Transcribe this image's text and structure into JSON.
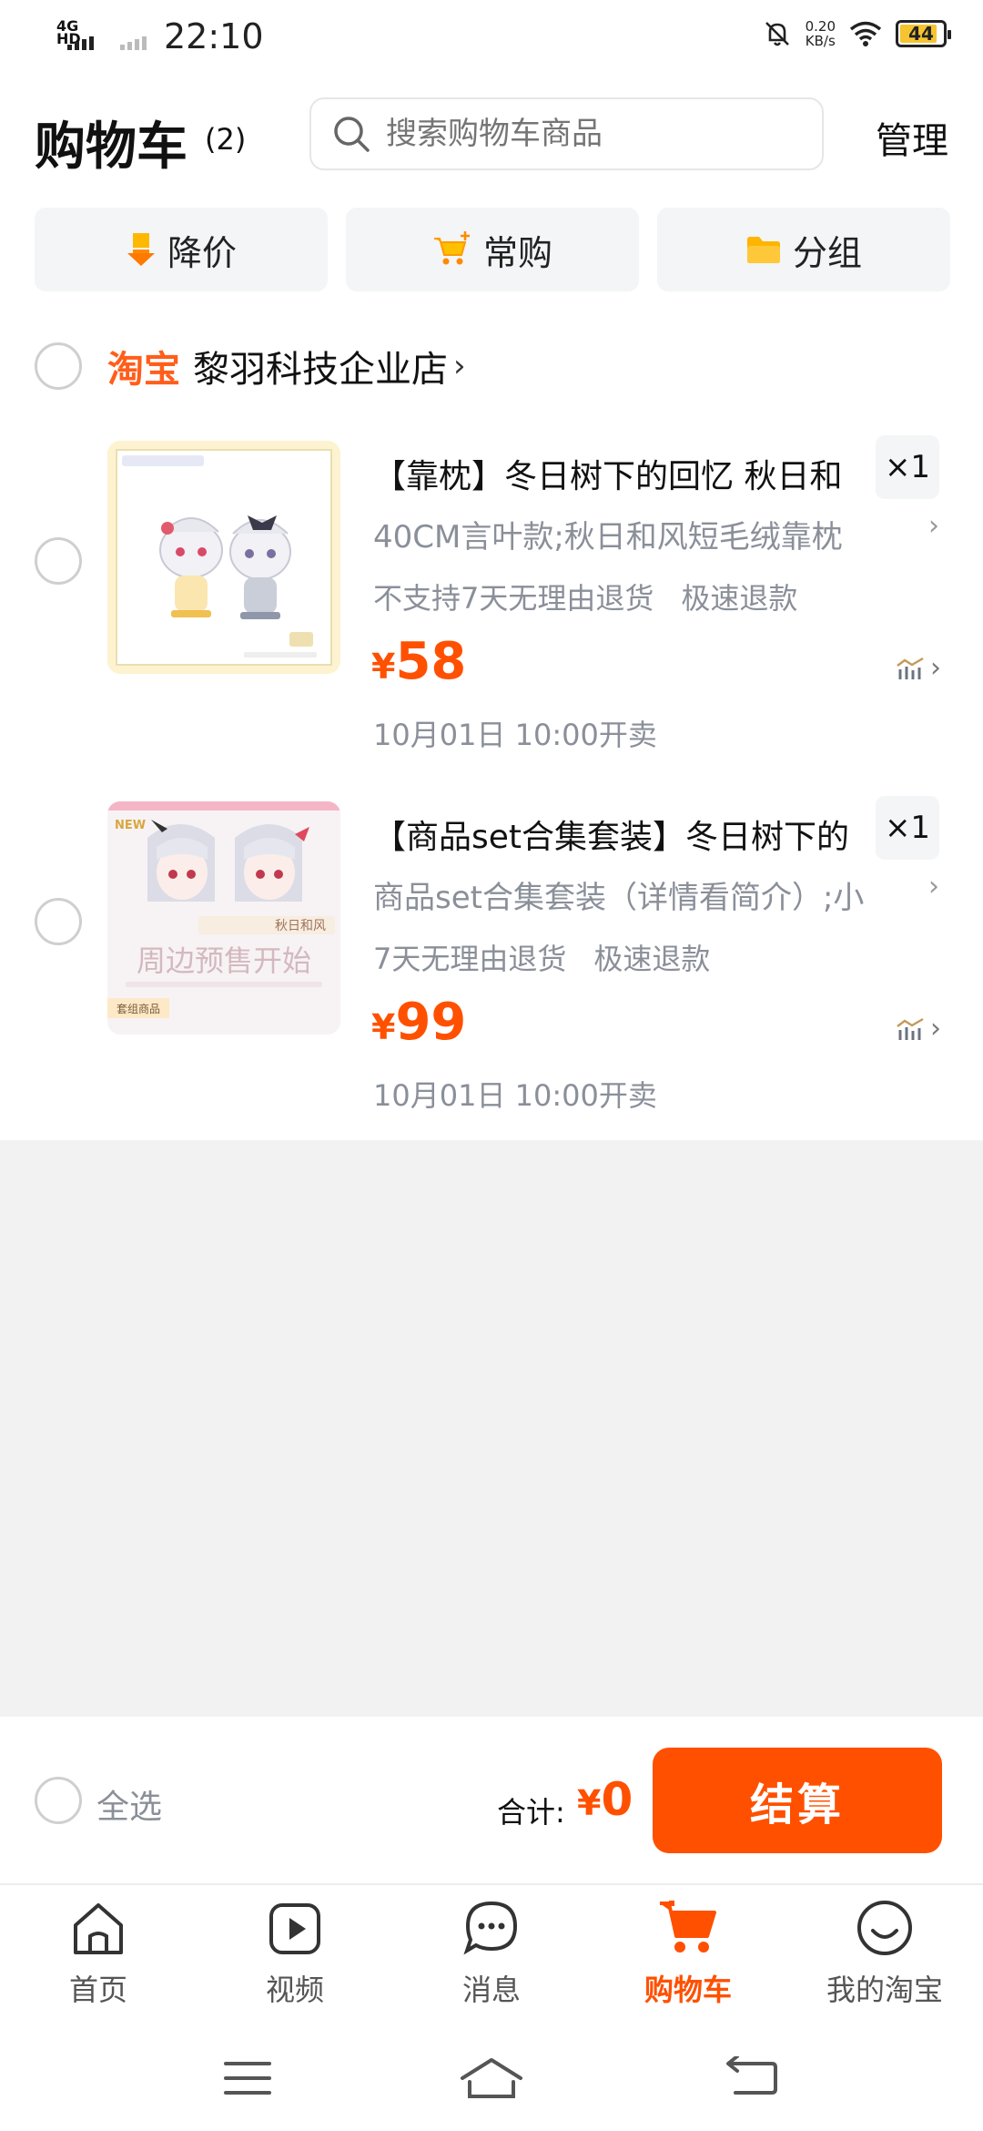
{
  "status_bar": {
    "network": "4G HD",
    "time": "22:10",
    "speed_value": "0.20",
    "speed_unit": "KB/s",
    "battery": "44"
  },
  "header": {
    "title": "购物车",
    "count": "(2)",
    "search_placeholder": "搜索购物车商品",
    "manage": "管理"
  },
  "filters": [
    {
      "label": "降价",
      "icon": "price-drop-icon"
    },
    {
      "label": "常购",
      "icon": "cart-plus-icon"
    },
    {
      "label": "分组",
      "icon": "folder-icon"
    }
  ],
  "shop": {
    "platform": "淘宝",
    "name": "黎羽科技企业店"
  },
  "items": [
    {
      "title": "【靠枕】冬日树下的回忆 秋日和",
      "qty": "×1",
      "sku": "40CM言叶款;秋日和风短毛绒靠枕",
      "tags": [
        "不支持7天无理由退货",
        "极速退款"
      ],
      "price_symbol": "¥",
      "price": "58",
      "sale_time": "10月01日 10:00开卖"
    },
    {
      "title": "【商品set合集套装】冬日树下的",
      "qty": "×1",
      "sku": "商品set合集套装（详情看简介）;小",
      "tags": [
        "7天无理由退货",
        "极速退款"
      ],
      "price_symbol": "¥",
      "price": "99",
      "sale_time": "10月01日 10:00开卖",
      "thumb_text": {
        "top_tag": "NEW",
        "name": "秋日和风",
        "headline": "周边预售开始",
        "badge": "套组商品"
      }
    }
  ],
  "checkout": {
    "select_all": "全选",
    "total_label": "合计:",
    "total_symbol": "¥",
    "total_value": "0",
    "pay_button": "结算"
  },
  "tabbar": [
    {
      "label": "首页",
      "icon": "home-icon"
    },
    {
      "label": "视频",
      "icon": "video-icon"
    },
    {
      "label": "消息",
      "icon": "message-icon"
    },
    {
      "label": "购物车",
      "icon": "cart-icon",
      "active": true
    },
    {
      "label": "我的淘宝",
      "icon": "profile-icon"
    }
  ],
  "colors": {
    "accent": "#ff5000",
    "brand": "#ff5e1a",
    "muted": "#8a8f99"
  }
}
